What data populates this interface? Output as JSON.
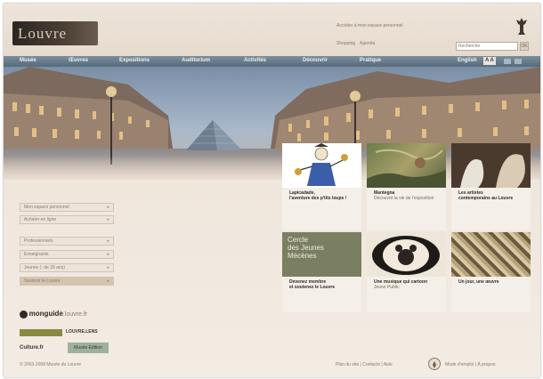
{
  "header": {
    "logo": "Louvre",
    "top_link": "Accéder à mon espace personnel",
    "links": [
      "Shopping",
      "Agenda"
    ],
    "search_placeholder": "Recherche",
    "search_button": "OK"
  },
  "nav": {
    "items": [
      "Musée",
      "Œuvres",
      "Expositions",
      "Auditorium",
      "Activités",
      "Découvrir",
      "Pratique"
    ],
    "language": "English",
    "text_size": "A A"
  },
  "menu": {
    "items": [
      "Mon espace personnel",
      "Acheter en ligne",
      "Professionnels",
      "Enseignants",
      "Jeunes (- de 26 ans)",
      "Soutenir le Louvre"
    ]
  },
  "tiles": [
    {
      "title": "Lapicadade,",
      "body": "l'aventure des p'tits loups !",
      "sub": ""
    },
    {
      "title": "Mantegna",
      "body": "Découvrir la vie de l'exposition",
      "sub": ""
    },
    {
      "title": "Les artistes",
      "body": "contemporains au Louvre",
      "sub": ""
    },
    {
      "title": "Devenez membre",
      "body": "et soutenez le Louvre",
      "sub": ""
    },
    {
      "title": "Une musique qui cartoon",
      "body": "",
      "sub": "Jeune Public"
    },
    {
      "title": "Un jour, une œuvre",
      "body": "",
      "sub": ""
    }
  ],
  "promo_text": {
    "line1": "Cercle",
    "line2": "des Jeunes",
    "line3": "Mécènes"
  },
  "partners": {
    "guide_brand": "monguide",
    "guide_rest": ".louvre.fr",
    "green_logo": "",
    "lens": "LOUVRE.LENS",
    "culture": "Culture.fr",
    "edition": "Musée Édition"
  },
  "footer": {
    "copyright": "© 2003-2008 Musée du Louvre",
    "links": "Plan du site  |  Contacts  |  Aide",
    "mode_link": "Mode d'emploi  |  À propos"
  },
  "colors": {
    "nav_bar": "#667a8b",
    "page_bg": "#efe6dc",
    "promo_panel": "#7a7f62"
  }
}
